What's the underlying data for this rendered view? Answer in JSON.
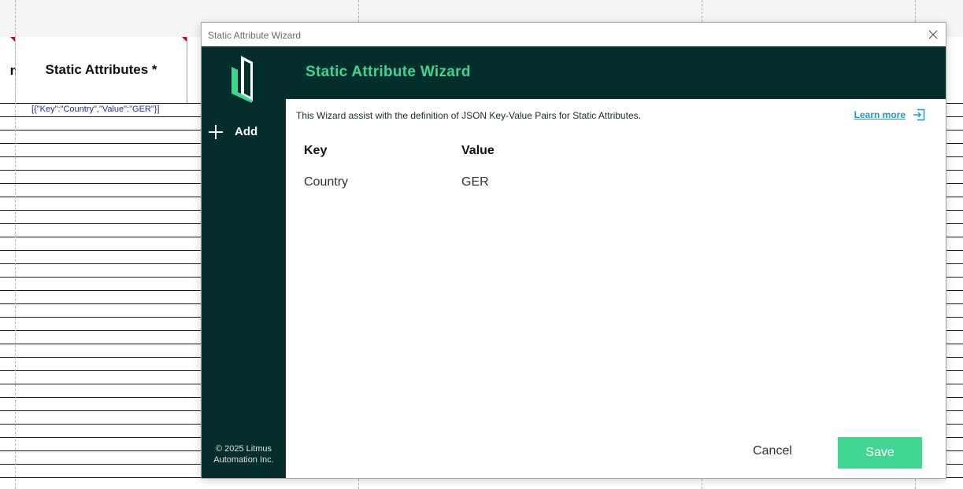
{
  "spreadsheet": {
    "left_header_fragment": "n",
    "column_header": "Static Attributes *",
    "cell_value": "[{\"Key\":\"Country\",\"Value\":\"GER\"}]"
  },
  "dialog": {
    "window_title": "Static Attribute Wizard",
    "close_icon": "close-icon",
    "sidebar": {
      "logo_icon": "litmus-logo",
      "add_label": "Add",
      "add_icon": "plus-icon",
      "copyright_line1": "© 2025 Litmus",
      "copyright_line2": "Automation Inc."
    },
    "header_title": "Static Attribute Wizard",
    "intro_text": "This Wizard assist with the definition of JSON Key-Value Pairs for Static Attributes.",
    "learn_more_label": "Learn more",
    "learn_more_icon": "external-link-icon",
    "table": {
      "columns": [
        "Key",
        "Value"
      ],
      "rows": [
        {
          "key": "Country",
          "value": "GER"
        }
      ]
    },
    "cancel_label": "Cancel",
    "save_label": "Save"
  },
  "colors": {
    "dark_green": "#032e2b",
    "accent_green": "#3ed68f",
    "save_green": "#41d693",
    "link_blue": "#1e9ac0"
  }
}
